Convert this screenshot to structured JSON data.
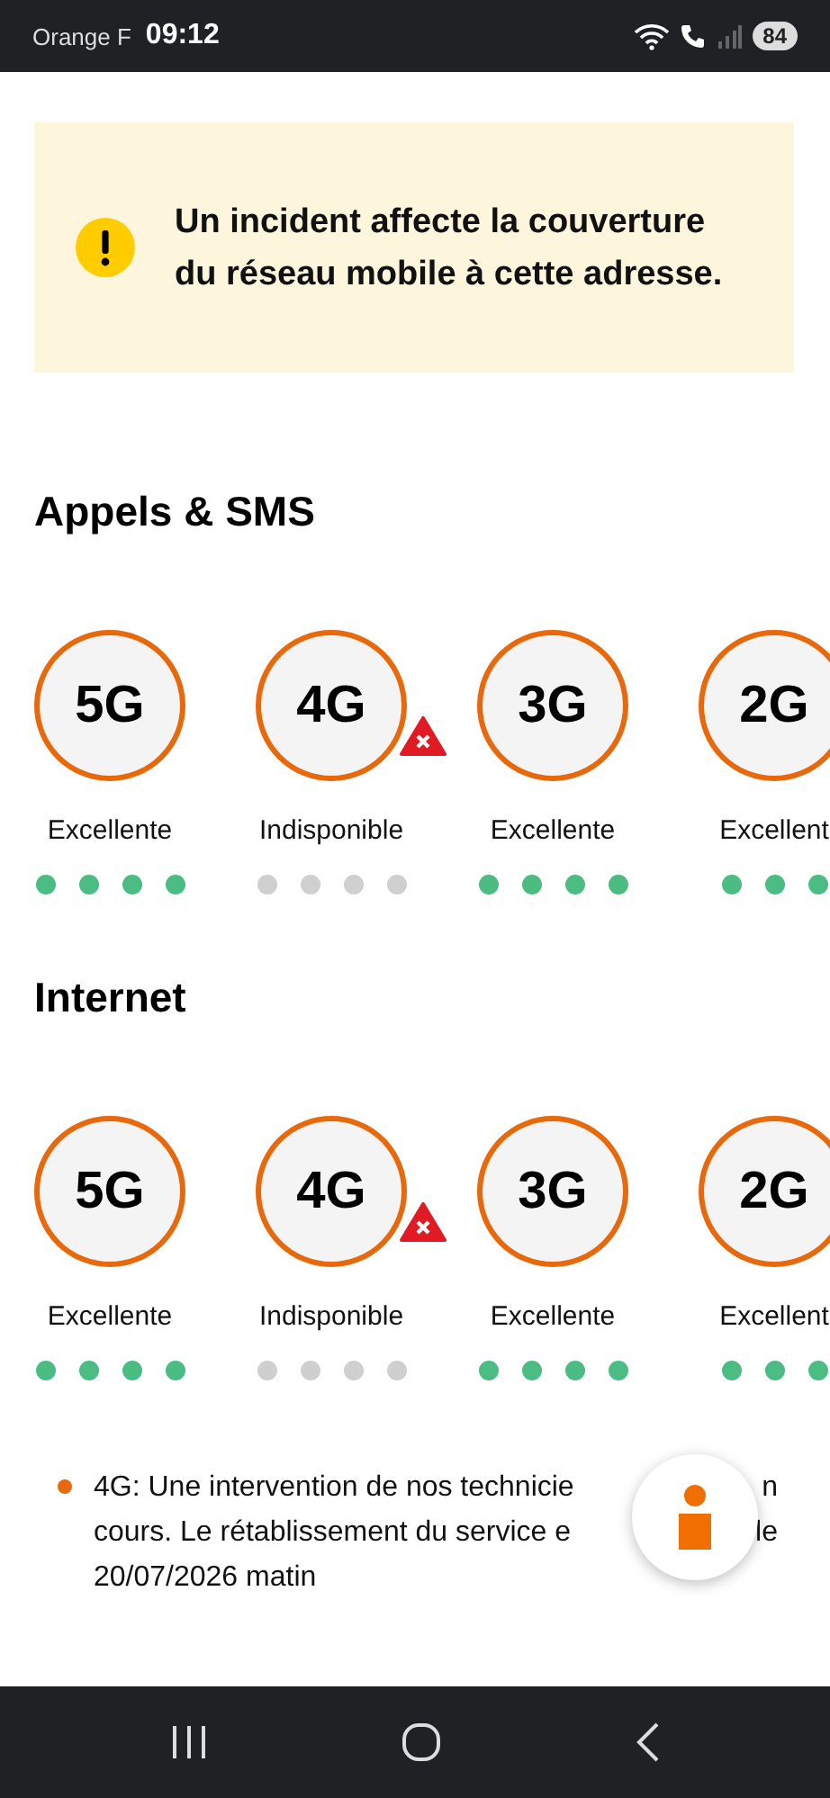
{
  "status_bar": {
    "carrier": "Orange F",
    "time": "09:12",
    "battery": "84"
  },
  "alert": {
    "text": "Un incident affecte la couverture du réseau mobile à cette adresse."
  },
  "sections": [
    {
      "title": "Appels & SMS",
      "networks": [
        {
          "label": "5G",
          "status": "Excellente",
          "stars": 4,
          "unavailable": false
        },
        {
          "label": "4G",
          "status": "Indisponible",
          "stars": 0,
          "unavailable": true
        },
        {
          "label": "3G",
          "status": "Excellente",
          "stars": 4,
          "unavailable": false
        },
        {
          "label": "2G",
          "status": "Excellent",
          "stars": 3,
          "unavailable": false
        }
      ]
    },
    {
      "title": "Internet",
      "networks": [
        {
          "label": "5G",
          "status": "Excellente",
          "stars": 4,
          "unavailable": false
        },
        {
          "label": "4G",
          "status": "Indisponible",
          "stars": 0,
          "unavailable": true
        },
        {
          "label": "3G",
          "status": "Excellente",
          "stars": 4,
          "unavailable": false
        },
        {
          "label": "2G",
          "status": "Excellent",
          "stars": 3,
          "unavailable": false
        }
      ]
    }
  ],
  "note": {
    "lines": [
      {
        "left": "4G: Une intervention de nos technicie",
        "right": "n"
      },
      {
        "left": "cours. Le rétablissement du service e",
        "right": "le"
      },
      {
        "left": "20/07/2026 matin"
      }
    ]
  }
}
